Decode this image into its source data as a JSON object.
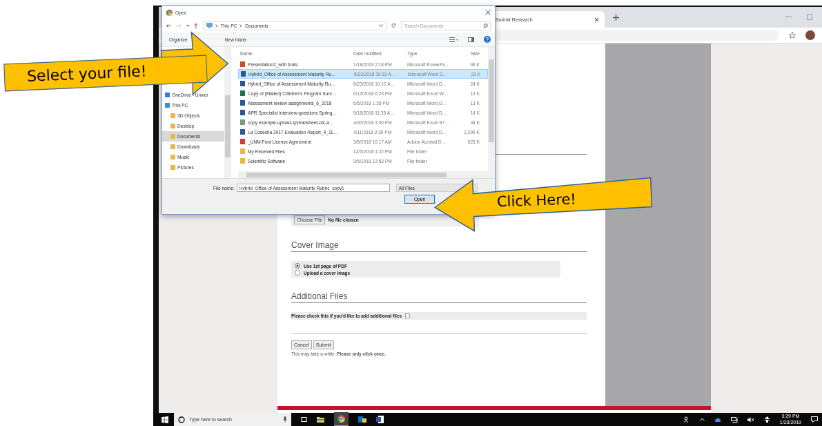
{
  "callout_select": "Select your file!",
  "callout_click": "Click Here!",
  "browser": {
    "tab_title": "Submit Research"
  },
  "page": {
    "upload": {
      "button": "Choose File",
      "status": "No file chosen"
    },
    "cover": {
      "heading": "Cover Image",
      "options": [
        {
          "label": "Use 1st page of PDF",
          "selected": true
        },
        {
          "label": "Upload a cover image",
          "selected": false
        }
      ]
    },
    "additional": {
      "heading": "Additional Files",
      "label": "Please check this if you'd like to add additional files",
      "checked": false
    },
    "buttons": [
      "Cancel",
      "Submit"
    ],
    "note": "This may take a while. **Please only click once.**"
  },
  "dialog": {
    "title": "Open",
    "path": [
      "This PC",
      "Documents"
    ],
    "search_placeholder": "Search Documents",
    "toolbar": [
      "Organize",
      "New folder"
    ],
    "nav": [
      {
        "label": "OneDrive - Univer",
        "kind": "cloud",
        "selected": false
      },
      {
        "label": "This PC",
        "kind": "pc",
        "selected": false,
        "children": [
          {
            "label": "3D Objects",
            "kind": "folder",
            "selected": false
          },
          {
            "label": "Desktop",
            "kind": "folder",
            "selected": false
          },
          {
            "label": "Documents",
            "kind": "folder",
            "selected": true
          },
          {
            "label": "Downloads",
            "kind": "folder",
            "selected": false
          },
          {
            "label": "Music",
            "kind": "folder",
            "selected": false
          },
          {
            "label": "Pictures",
            "kind": "folder",
            "selected": false
          }
        ]
      }
    ],
    "columns": [
      "Name",
      "Date modified",
      "Type",
      "Size"
    ],
    "rows": [
      {
        "kind": "powerpoint",
        "selected": false,
        "cells": [
          "Presentation2_with fonts",
          "1/18/2019 2:18 PM",
          "Microsoft PowerPo…",
          "99 K"
        ]
      },
      {
        "kind": "word",
        "selected": true,
        "cells": [
          "Hybrid_Office of Assessment Maturity Ru…",
          "8/23/2018 10:33 A…",
          "Microsoft Word D…",
          "23 K"
        ]
      },
      {
        "kind": "word",
        "selected": false,
        "cells": [
          "Hybrid_Office of Assessment Maturity Ru…",
          "8/23/2018 10:10 A…",
          "Microsoft Word D…",
          "24 K"
        ]
      },
      {
        "kind": "excel",
        "selected": false,
        "cells": [
          "Copy of (Mailed) Children's Program Surv…",
          "6/13/2018 6:23 PM",
          "Microsoft Excel W…",
          "13 K"
        ]
      },
      {
        "kind": "word",
        "selected": false,
        "cells": [
          "Assessment review assignments_6_2018",
          "6/5/2018 1:35 PM",
          "Microsoft Word D…",
          "13 K"
        ]
      },
      {
        "kind": "word",
        "selected": false,
        "cells": [
          "APR Specialist interview questions Spring…",
          "5/18/2018 11:35 A…",
          "Microsoft Word D…",
          "14 K"
        ]
      },
      {
        "kind": "sheet",
        "selected": false,
        "cells": [
          "copy example-upload-spreadsheet-ofc-a…",
          "4/30/2018 3:50 PM",
          "Microsoft Excel 97…",
          "34 K"
        ]
      },
      {
        "kind": "word",
        "selected": false,
        "cells": [
          "La Cosecha 2017 Evaluation Report_4_11…",
          "4/11/2018 2:39 PM",
          "Microsoft Word D…",
          "2,299 K"
        ]
      },
      {
        "kind": "pdf",
        "selected": false,
        "cells": [
          "_UNM Font License Agreement",
          "3/5/2018 10:17 AM",
          "Adobe Acrobat D…",
          "623 K"
        ]
      },
      {
        "kind": "folder",
        "selected": false,
        "cells": [
          "My Received Files",
          "12/5/2018 1:22 PM",
          "File folder",
          ""
        ]
      },
      {
        "kind": "folder",
        "selected": false,
        "cells": [
          "Scientific Software",
          "9/5/2018 12:53 PM",
          "File folder",
          ""
        ]
      }
    ],
    "file_name_label": "File name:",
    "file_name": "Hybrid_Office of Assessment Maturity Rubric_copy1",
    "filter": "All Files",
    "open_button": "Open"
  },
  "taskbar": {
    "search_placeholder": "Type here to search",
    "time": "3:29 PM",
    "date": "1/23/2019"
  }
}
